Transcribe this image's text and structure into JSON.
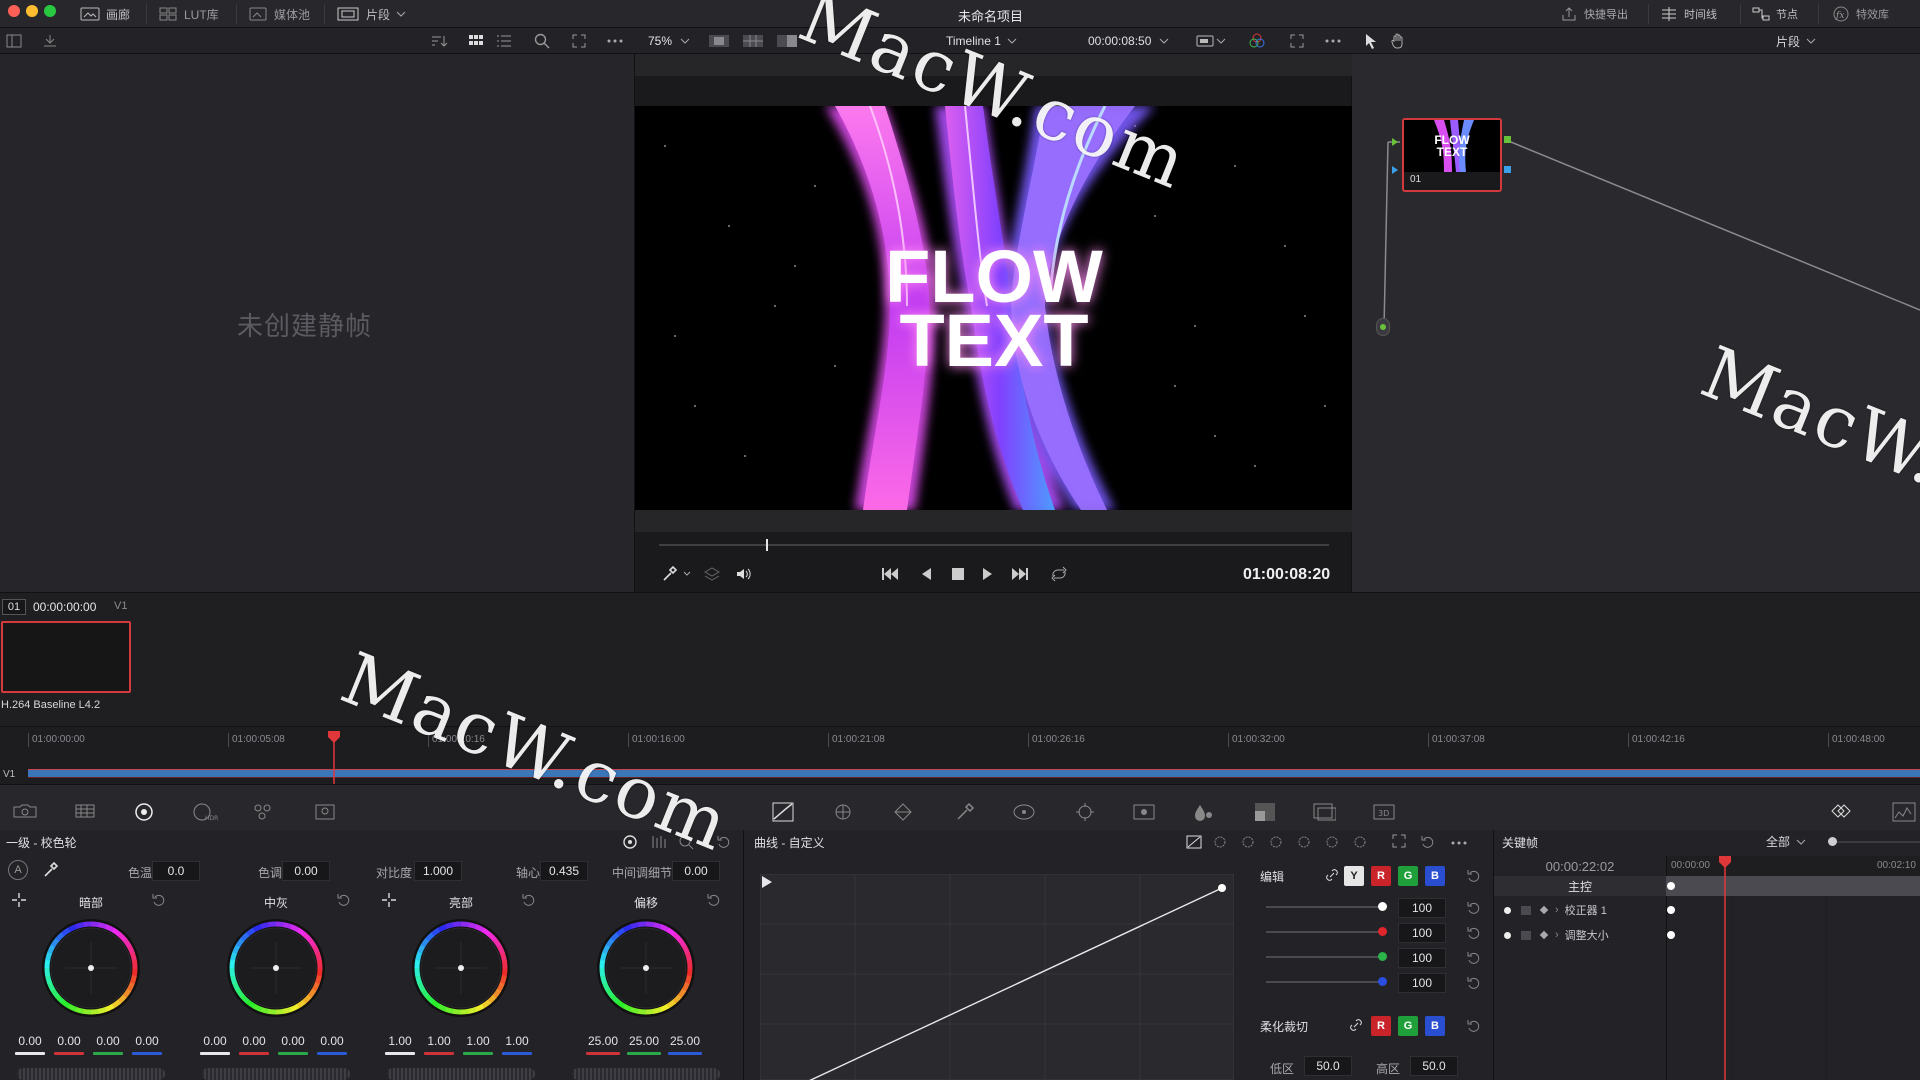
{
  "app": {
    "project_title": "未命名项目",
    "pages": [
      "画廊",
      "LUT库",
      "媒体池",
      "片段"
    ],
    "right_pages": [
      "快捷导出",
      "时间线",
      "节点",
      "特效库"
    ]
  },
  "toolbar": {
    "zoom": "75%",
    "timeline_name": "Timeline 1",
    "timecode": "00:00:08:50",
    "right_mode": "片段"
  },
  "gallery": {
    "empty_text": "未创建静帧"
  },
  "viewer": {
    "title_line1": "FLOW",
    "title_line2": "TEXT",
    "transport_timecode": "01:00:08:20",
    "scrub_fraction": 0.16
  },
  "nodes": {
    "node_label": "01"
  },
  "clip": {
    "index": "01",
    "timecode": "00:00:00:00",
    "track": "V1",
    "codec": "H.264 Baseline L4.2"
  },
  "timeline": {
    "ticks": [
      "01:00:00:00",
      "01:00:05:08",
      "01:00:10:16",
      "01:00:16:00",
      "01:00:21:08",
      "01:00:26:16",
      "01:00:32:00",
      "01:00:37:08",
      "01:00:42:16",
      "01:00:48:00"
    ],
    "track_label": "V1",
    "playhead_fraction": 0.17
  },
  "wheels": {
    "title": "一级 - 校色轮",
    "temp_label": "色温",
    "temp_value": "0.0",
    "tint_label": "色调",
    "tint_value": "0.00",
    "contrast_label": "对比度",
    "contrast_value": "1.000",
    "pivot_label": "轴心",
    "pivot_value": "0.435",
    "middetail_label": "中间调细节",
    "middetail_value": "0.00",
    "auto_label": "A",
    "lift": {
      "name": "暗部",
      "values": [
        "0.00",
        "0.00",
        "0.00",
        "0.00"
      ]
    },
    "gamma": {
      "name": "中灰",
      "values": [
        "0.00",
        "0.00",
        "0.00",
        "0.00"
      ]
    },
    "gain": {
      "name": "亮部",
      "values": [
        "1.00",
        "1.00",
        "1.00",
        "1.00"
      ]
    },
    "offset": {
      "name": "偏移",
      "values": [
        "25.00",
        "25.00",
        "25.00"
      ]
    }
  },
  "curves": {
    "title": "曲线 - 自定义",
    "edit_label": "编辑",
    "channels": [
      "Y",
      "R",
      "G",
      "B"
    ],
    "intensity": [
      "100",
      "100",
      "100",
      "100"
    ],
    "soft_clip_label": "柔化裁切",
    "low_label": "低区",
    "low_value": "50.0",
    "high_label": "高区",
    "high_value": "50.0"
  },
  "keyframes": {
    "title": "关键帧",
    "filter": "全部",
    "timecode": "00:00:22:02",
    "ruler_start": "00:00:00",
    "ruler_end": "00:02:10",
    "rows": [
      "主控",
      "校正器 1",
      "调整大小"
    ]
  },
  "watermark": "MacW.com",
  "colors": {
    "accent_red": "#e0373a",
    "clip_border": "#d23a3e",
    "track_blue": "#3a76b8",
    "node_green": "#67c23a",
    "node_blue": "#3aa0e8"
  }
}
